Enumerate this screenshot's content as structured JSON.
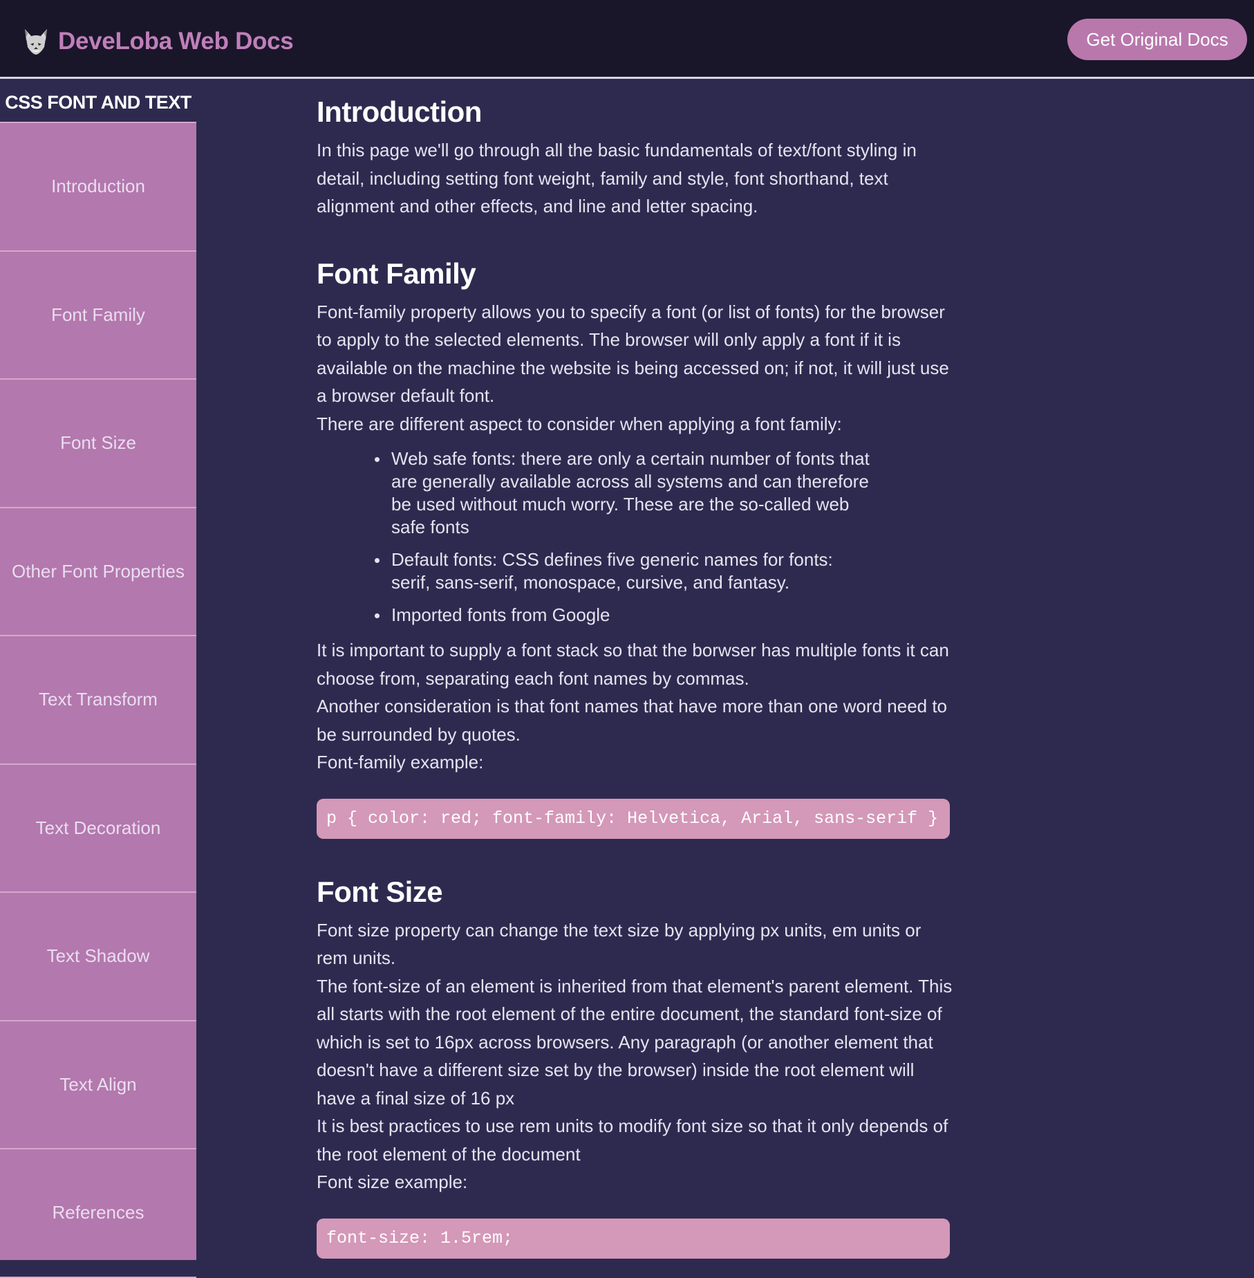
{
  "header": {
    "brand": "DeveLoba Web Docs",
    "cta_label": "Get Original Docs"
  },
  "sidebar": {
    "title": "CSS FONT AND TEXT",
    "items": [
      {
        "label": "Introduction"
      },
      {
        "label": "Font Family"
      },
      {
        "label": "Font Size"
      },
      {
        "label": "Other Font Properties"
      },
      {
        "label": "Text Transform"
      },
      {
        "label": "Text Decoration"
      },
      {
        "label": "Text Shadow"
      },
      {
        "label": "Text Align"
      },
      {
        "label": "References"
      }
    ]
  },
  "main": {
    "intro": {
      "title": "Introduction",
      "p1": "In this page we'll go through all the basic fundamentals of text/font styling in detail, including setting font weight, family and style, font shorthand, text alignment and other effects, and line and letter spacing."
    },
    "font_family": {
      "title": "Font Family",
      "p1": "Font-family property allows you to specify a font (or list of fonts) for the browser to apply to the selected elements. The browser will only apply a font if it is available on the machine the website is being accessed on; if not, it will just use a browser default font.",
      "p2": "There are different aspect to consider when applying a font family:",
      "bullets": [
        "Web safe fonts: there are only a certain number of fonts that are generally available across all systems and can therefore be used without much worry. These are the so-called web safe fonts",
        "Default fonts: CSS defines five generic names for fonts: serif, sans-serif, monospace, cursive, and fantasy.",
        "Imported fonts from Google"
      ],
      "p3": "It is important to supply a font stack so that the borwser has multiple fonts it can choose from, separating each font names by commas.",
      "p4": "Another consideration is that font names that have more than one word need to be surrounded by quotes.",
      "p5": "Font-family example:",
      "code": "p { color: red; font-family: Helvetica, Arial, sans-serif }"
    },
    "font_size": {
      "title": "Font Size",
      "p1": "Font size property can change the text size by applying px units, em units or rem units.",
      "p2": "The font-size of an element is inherited from that element's parent element. This all starts with the root element of the entire document, the standard font-size of which is set to 16px across browsers. Any paragraph (or another element that doesn't have a different size set by the browser) inside the root element will have a final size of 16 px",
      "p3": "It is best practices to use rem units to modify font size so that it only depends of the root element of the document",
      "p4": "Font size example:",
      "code": "font-size: 1.5rem;"
    }
  }
}
